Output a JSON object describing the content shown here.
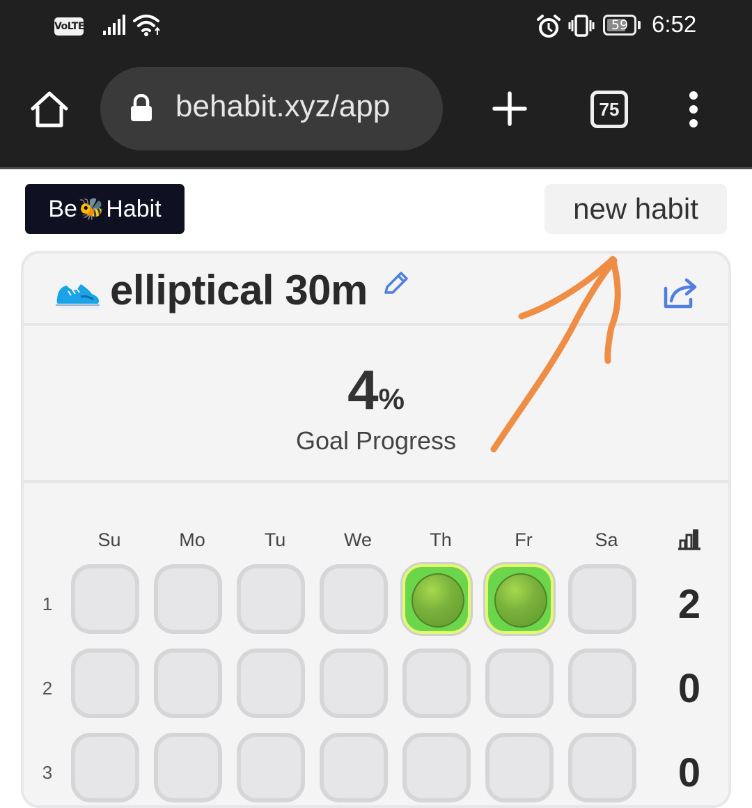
{
  "status_bar": {
    "volte": "VoLTE",
    "battery": "59",
    "time": "6:52"
  },
  "browser": {
    "url": "behabit.xyz/app",
    "tab_count": "75"
  },
  "app": {
    "logo_prefix": "Be",
    "logo_emoji": "🐝",
    "logo_suffix": "Habit",
    "new_habit_label": "new habit"
  },
  "habit": {
    "title": "elliptical 30m",
    "progress_value": "4",
    "progress_unit": "%",
    "progress_label": "Goal Progress",
    "days": [
      "Su",
      "Mo",
      "Tu",
      "We",
      "Th",
      "Fr",
      "Sa"
    ],
    "weeks": [
      {
        "label": "1",
        "total": "2",
        "done": [
          false,
          false,
          false,
          false,
          true,
          true,
          false
        ]
      },
      {
        "label": "2",
        "total": "0",
        "done": [
          false,
          false,
          false,
          false,
          false,
          false,
          false
        ]
      },
      {
        "label": "3",
        "total": "0",
        "done": [
          false,
          false,
          false,
          false,
          false,
          false,
          false
        ]
      }
    ]
  },
  "colors": {
    "bar_bg": "#202020",
    "url_pill": "#3a3a3a",
    "logo_bg": "#0f1022",
    "accent_blue": "#4f7fe0",
    "done_green": "#6bd64c",
    "annotation_orange": "#f08d45"
  }
}
